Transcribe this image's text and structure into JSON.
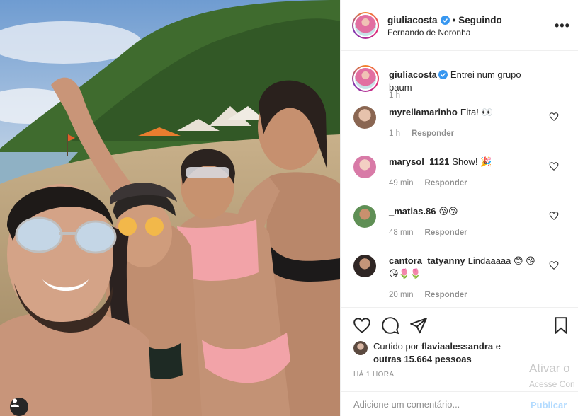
{
  "post": {
    "author": "giuliacosta",
    "follow_status": "Seguindo",
    "separator": "•",
    "location": "Fernando de Noronha",
    "more_icon": "more-options-icon"
  },
  "caption": {
    "user": "giuliacosta",
    "text": "Entrei num grupo baum",
    "time": "1 h"
  },
  "comments": [
    {
      "user": "myrellamarinho",
      "text": "Eita! 👀",
      "time": "1 h",
      "reply": "Responder",
      "avatar_color": "#c9a38c"
    },
    {
      "user": "marysol_1121",
      "text": "Show! 🎉",
      "time": "49 min",
      "reply": "Responder",
      "avatar_color": "#e7a8c0"
    },
    {
      "user": "_matias.86",
      "text": "😘😘",
      "time": "48 min",
      "reply": "Responder",
      "avatar_color": "#7aa86e"
    },
    {
      "user": "cantora_tatyanny",
      "text": "Lindaaaaa 😊 😘😘🌷🌷",
      "time": "20 min",
      "reply": "Responder",
      "avatar_color": "#5a4a44"
    }
  ],
  "likes": {
    "prefix": "Curtido por",
    "user": "flaviaalessandra",
    "and": "e",
    "others": "outras 15.664 pessoas"
  },
  "time_ago": "HÁ 1 HORA",
  "add_comment": {
    "placeholder": "Adicione um comentário...",
    "publish": "Publicar"
  },
  "watermark": {
    "line1": "Ativar o",
    "line2": "Acesse Con"
  },
  "colors": {
    "verified": "#3897f0",
    "publish_disabled": "#b3dbff",
    "secondary_text": "#8e8e8e"
  }
}
